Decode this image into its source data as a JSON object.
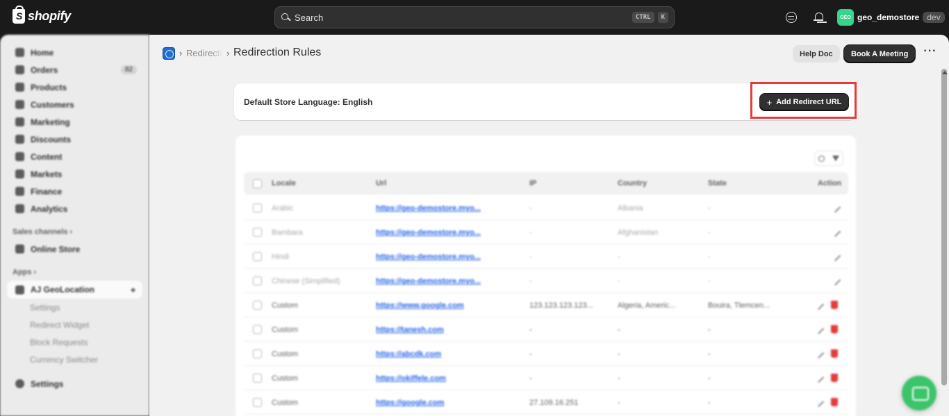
{
  "topbar": {
    "brand": "shopify",
    "search_placeholder": "Search",
    "kbd_ctrl": "CTRL",
    "kbd_k": "K",
    "avatar_initials": "GEO",
    "store_name": "geo_demostore",
    "env_badge": "dev"
  },
  "sidebar": {
    "items": [
      {
        "label": "Home"
      },
      {
        "label": "Orders",
        "badge": "82"
      },
      {
        "label": "Products"
      },
      {
        "label": "Customers"
      },
      {
        "label": "Marketing"
      },
      {
        "label": "Discounts"
      },
      {
        "label": "Content"
      },
      {
        "label": "Markets"
      },
      {
        "label": "Finance"
      },
      {
        "label": "Analytics"
      }
    ],
    "sales_channels_label": "Sales channels",
    "online_store_label": "Online Store",
    "apps_label": "Apps",
    "app_name": "AJ GeoLocation",
    "app_subitems": [
      "Settings",
      "Redirect Widget",
      "Block Requests",
      "Currency Switcher"
    ],
    "settings_label": "Settings"
  },
  "header": {
    "breadcrumb_parent": "Redirection Rules",
    "title": "Redirection Rules",
    "help_doc_label": "Help Doc",
    "book_meeting_label": "Book A Meeting",
    "more_label": "···"
  },
  "language_card": {
    "text": "Default Store Language: English",
    "add_button_label": "Add Redirect URL"
  },
  "table": {
    "columns": [
      "Locale",
      "Url",
      "IP",
      "Country",
      "State",
      "Action"
    ],
    "rows": [
      {
        "locale": "Arabic",
        "url": "https://geo-demostore.myo...",
        "ip": "-",
        "country": "Albania",
        "state": "-",
        "deletable": false
      },
      {
        "locale": "Bambara",
        "url": "https://geo-demostore.myo...",
        "ip": "-",
        "country": "Afghanistan",
        "state": "-",
        "deletable": false
      },
      {
        "locale": "Hindi",
        "url": "https://geo-demostore.myo...",
        "ip": "-",
        "country": "-",
        "state": "-",
        "deletable": false
      },
      {
        "locale": "Chinese (Simplified)",
        "url": "https://geo-demostore.myo...",
        "ip": "-",
        "country": "-",
        "state": "-",
        "deletable": false
      },
      {
        "locale": "Custom",
        "url": "https://www.google.com",
        "ip": "123.123.123.123...",
        "country": "Algeria, Americ...",
        "state": "Bouira, Tlemcen...",
        "deletable": true
      },
      {
        "locale": "Custom",
        "url": "https://tanesh.com",
        "ip": "-",
        "country": "-",
        "state": "-",
        "deletable": true
      },
      {
        "locale": "Custom",
        "url": "https://abcdk.com",
        "ip": "-",
        "country": "-",
        "state": "-",
        "deletable": true
      },
      {
        "locale": "Custom",
        "url": "https://okiffele.com",
        "ip": "-",
        "country": "-",
        "state": "-",
        "deletable": true
      },
      {
        "locale": "Custom",
        "url": "https://google.com",
        "ip": "27.109.16.251",
        "country": "-",
        "state": "-",
        "deletable": true
      }
    ]
  },
  "colors": {
    "topbar_bg": "#1a1a1a",
    "main_bg": "#f1f1f1",
    "primary_button": "#303030",
    "highlight": "#e53b3b",
    "link": "#2463eb",
    "chat_fab": "#3dc46a"
  }
}
